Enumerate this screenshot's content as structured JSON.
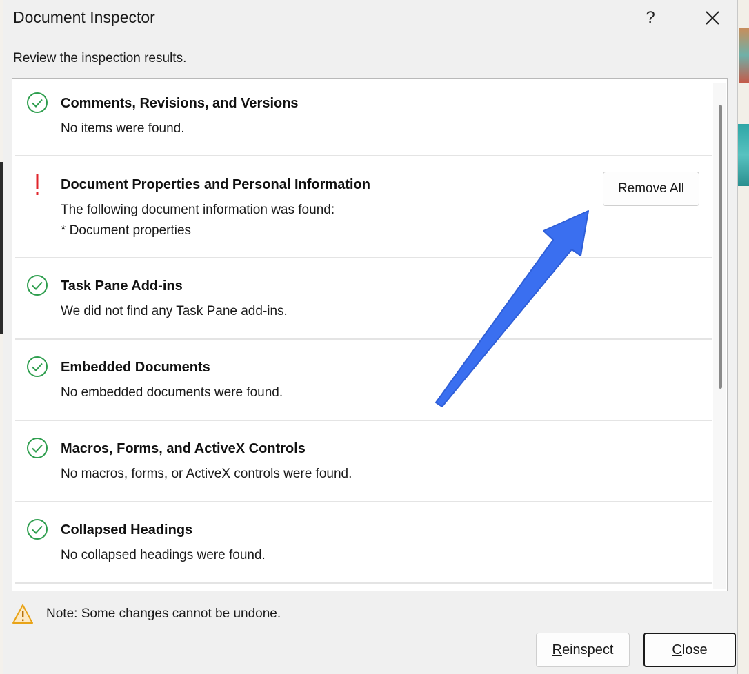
{
  "dialog": {
    "title": "Document Inspector",
    "help_label": "?",
    "subtitle": "Review the inspection results."
  },
  "results": [
    {
      "status": "ok",
      "heading": "Comments, Revisions, and Versions",
      "detail_lines": [
        "No items were found."
      ]
    },
    {
      "status": "warning",
      "heading": "Document Properties and Personal Information",
      "detail_lines": [
        "The following document information was found:",
        "* Document properties"
      ],
      "action_label": "Remove All"
    },
    {
      "status": "ok",
      "heading": "Task Pane Add-ins",
      "detail_lines": [
        "We did not find any Task Pane add-ins."
      ]
    },
    {
      "status": "ok",
      "heading": "Embedded Documents",
      "detail_lines": [
        "No embedded documents were found."
      ]
    },
    {
      "status": "ok",
      "heading": "Macros, Forms, and ActiveX Controls",
      "detail_lines": [
        "No macros, forms, or ActiveX controls were found."
      ]
    },
    {
      "status": "ok",
      "heading": "Collapsed Headings",
      "detail_lines": [
        "No collapsed headings were found."
      ]
    }
  ],
  "footer": {
    "note": "Note: Some changes cannot be undone.",
    "reinspect": {
      "accel": "R",
      "rest": "einspect"
    },
    "close": {
      "accel": "C",
      "rest": "lose"
    }
  },
  "colors": {
    "ok": "#2e9e4e",
    "warning": "#e0242b",
    "annotation_arrow": "#3a6ff0",
    "note_icon": "#e8a317"
  }
}
